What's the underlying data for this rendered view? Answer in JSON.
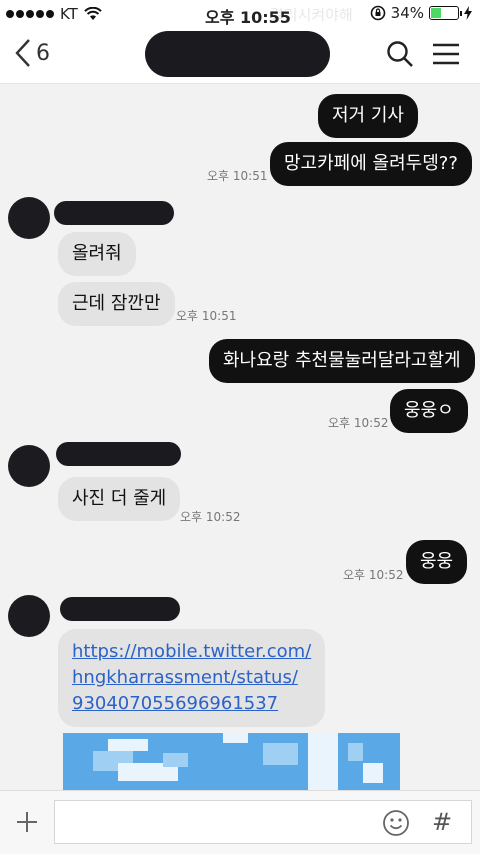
{
  "status_bar": {
    "carrier": "KT",
    "time": "오후 10:55",
    "battery_percent": "34%",
    "battery_level": 0.34,
    "overlay_text": "렬리시켜야해"
  },
  "nav": {
    "back_count": "6",
    "icons": [
      "chevron-left-icon",
      "search-icon",
      "menu-icon"
    ]
  },
  "messages": [
    {
      "side": "out",
      "text": "저거 기사"
    },
    {
      "side": "out",
      "text": "망고카페에 올려두뎅??",
      "time": "오후 10:51"
    },
    {
      "side": "in",
      "text": "올려줘"
    },
    {
      "side": "in",
      "text": "근데 잠깐만",
      "time": "오후 10:51"
    },
    {
      "side": "out",
      "text": "화나요랑 추천물눌러달라고할게"
    },
    {
      "side": "out",
      "text": "웅웅ㅇ",
      "time": "오후 10:52"
    },
    {
      "side": "in",
      "text": "사진 더 줄게",
      "time": "오후 10:52"
    },
    {
      "side": "out",
      "text": "웅웅",
      "time": "오후 10:52"
    },
    {
      "side": "in",
      "link_lines": [
        "https://mobile.twitter.com/",
        "hngkharrassment/status/",
        "930407055696961537"
      ]
    }
  ],
  "input_bar": {
    "hash_label": "#",
    "icons": [
      "plus-icon",
      "emoji-icon"
    ]
  },
  "colors": {
    "outgoing_bubble": "#111111",
    "incoming_bubble": "#e3e3e3",
    "link": "#2b62c8",
    "battery_fill": "#4cd964"
  }
}
